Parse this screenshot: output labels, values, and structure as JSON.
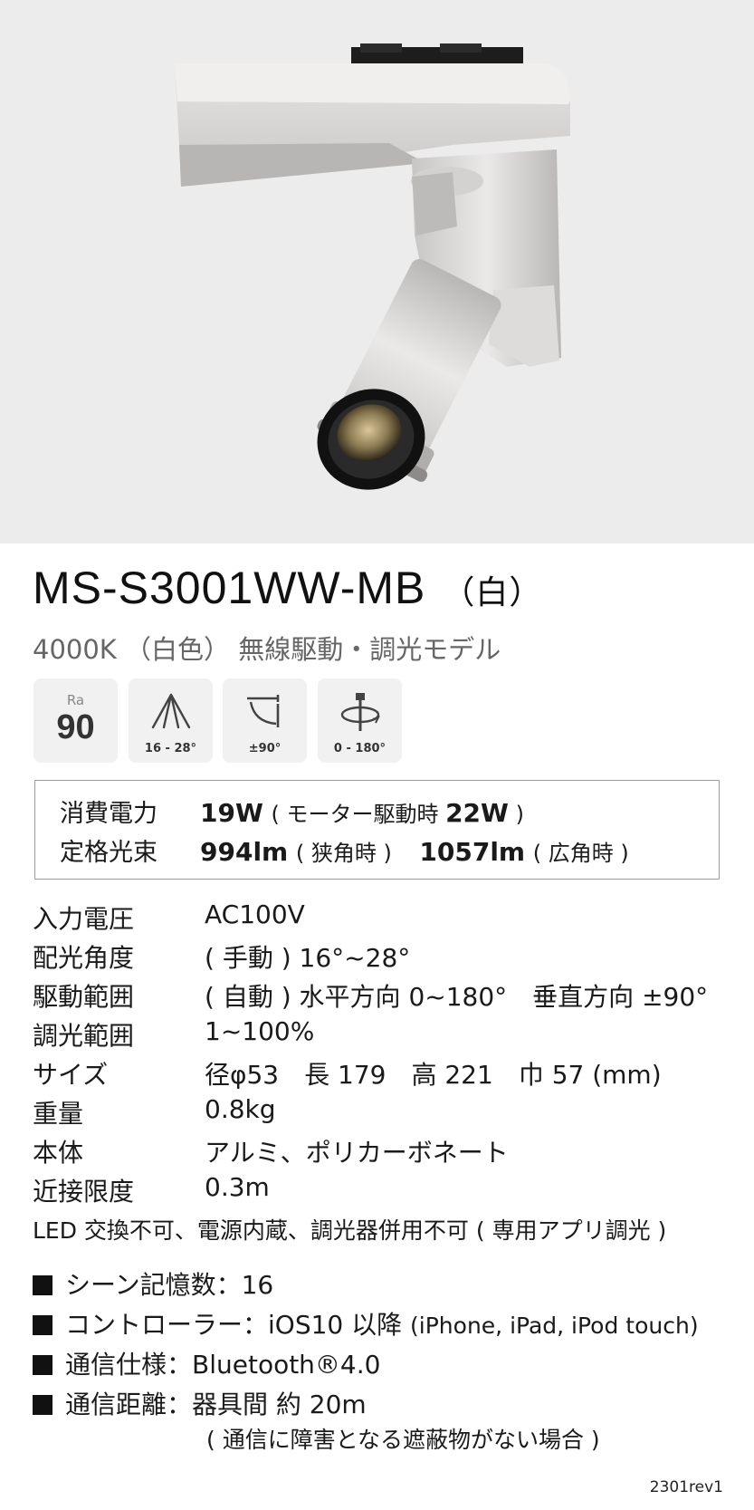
{
  "model": {
    "code": "MS-S3001WW-MB",
    "suffix": "（白）"
  },
  "subtitle": "4000K （白色） 無線駆動・調光モデル",
  "icons": {
    "ra": {
      "label": "Ra",
      "value": "90"
    },
    "beam": {
      "caption": "16 - 28°"
    },
    "tilt": {
      "caption": "±90°"
    },
    "rotate": {
      "caption": "0 - 180°"
    }
  },
  "power": {
    "label": "消費電力",
    "value": "19W",
    "note_pre": "( モーター駆動時 ",
    "note_value": "22W",
    "note_post": " )"
  },
  "flux": {
    "label": "定格光束",
    "narrow_value": "994lm",
    "narrow_note": "( 狭角時 )",
    "wide_value": "1057lm",
    "wide_note": "( 広角時 )"
  },
  "specs": [
    {
      "key": "入力電圧",
      "value": "AC100V"
    },
    {
      "key": "配光角度",
      "value": "( 手動 ) 16°~28°"
    },
    {
      "key": "駆動範囲",
      "value": "( 自動 ) 水平方向 0~180°　垂直方向 ±90°"
    },
    {
      "key": "調光範囲",
      "value": "1~100%"
    },
    {
      "key": "サイズ",
      "value": "径φ53　長 179　高 221　巾 57 (mm)"
    },
    {
      "key": "重量",
      "value": "0.8kg"
    },
    {
      "key": "本体",
      "value": "アルミ、ポリカーボネート"
    },
    {
      "key": "近接限度",
      "value": "0.3m"
    }
  ],
  "note": "LED 交換不可、電源内蔵、調光器併用不可 ( 専用アプリ調光 )",
  "features": [
    {
      "label": "シーン記憶数：16",
      "extra": ""
    },
    {
      "label": "コントローラー：iOS10 以降 ",
      "extra": "(iPhone, iPad, iPod touch)"
    },
    {
      "label": "通信仕様：Bluetooth®4.0",
      "extra": ""
    },
    {
      "label": "通信距離：器具間 約 20m",
      "extra": ""
    }
  ],
  "feature_sub": "( 通信に障害となる遮蔽物がない場合 )",
  "revision": "2301rev1"
}
